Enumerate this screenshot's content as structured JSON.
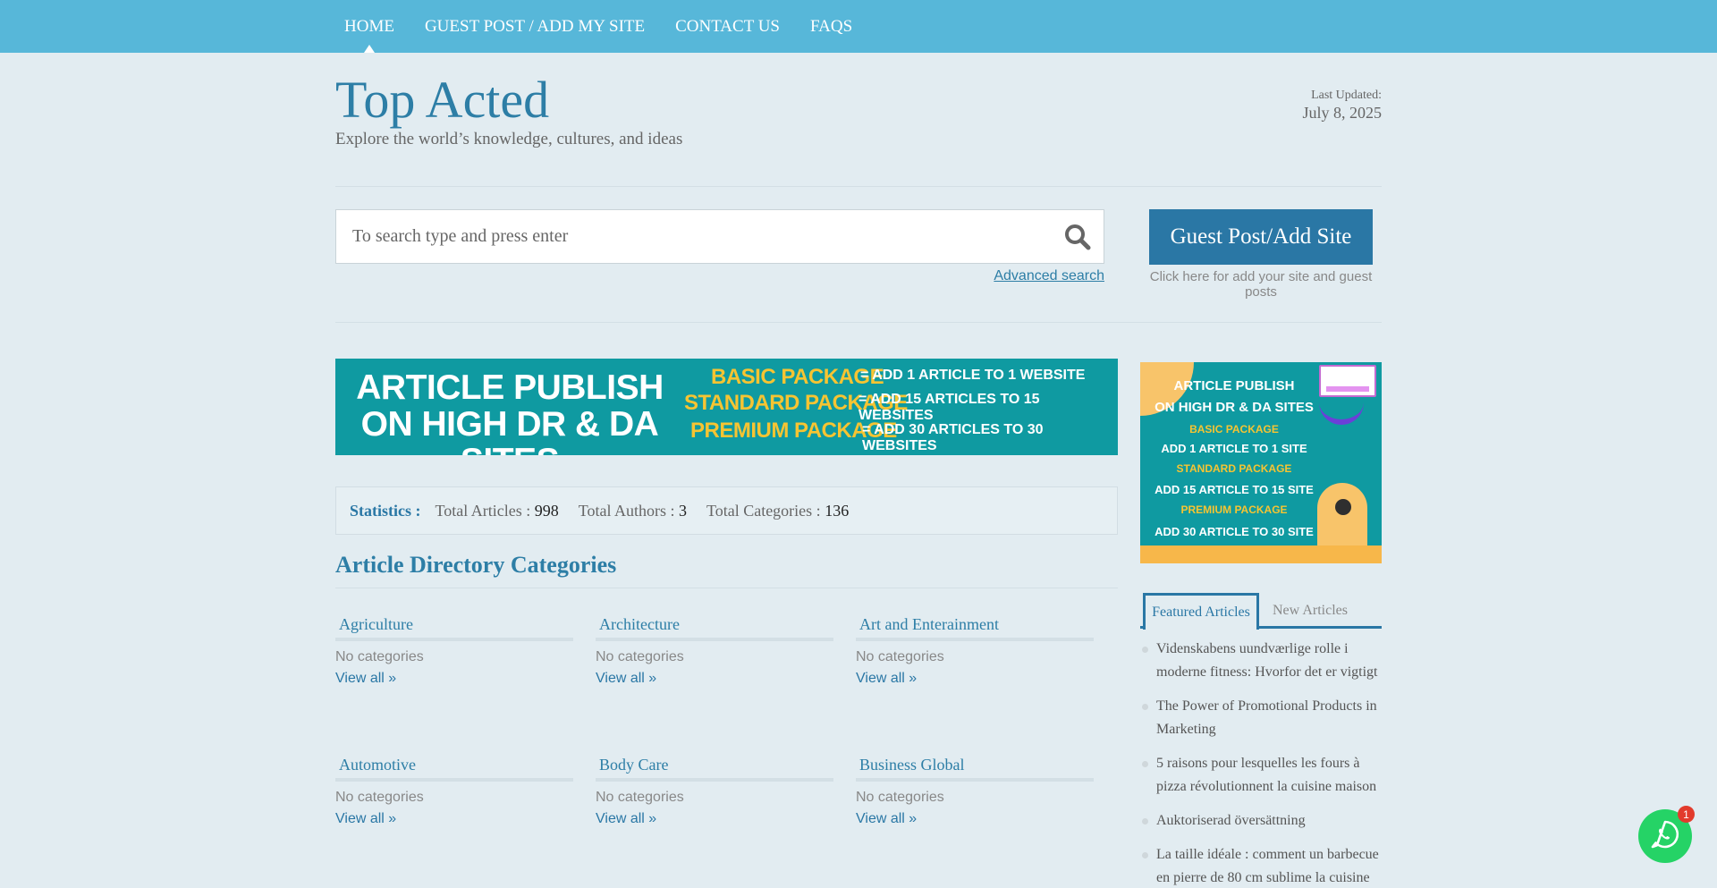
{
  "nav": {
    "items": [
      {
        "label": "HOME"
      },
      {
        "label": "GUEST POST / ADD MY SITE"
      },
      {
        "label": "CONTACT US"
      },
      {
        "label": "FAQS"
      }
    ]
  },
  "header": {
    "title": "Top Acted",
    "description": "Explore the world’s knowledge, cultures, and ideas",
    "updated_label": "Last Updated:",
    "updated_date": "July 8, 2025"
  },
  "search": {
    "placeholder": "To search type and press enter",
    "advanced_label": "Advanced search"
  },
  "guest_post": {
    "button_label": "Guest Post/Add Site",
    "caption": "Click here for add your site and guest posts"
  },
  "banner": {
    "title_line1": "ARTICLE PUBLISH",
    "title_line2": "ON HIGH DR & DA SITES",
    "packages": [
      {
        "name": "BASIC PACKAGE",
        "desc": "= ADD 1 ARTICLE TO 1 WEBSITE"
      },
      {
        "name": "STANDARD PACKAGE",
        "desc": "= ADD 15 ARTICLES TO 15 WEBSITES"
      },
      {
        "name": "PREMIUM PACKAGE",
        "desc": "= ADD 30 ARTICLES TO 30 WEBSITES"
      }
    ]
  },
  "side_ad": {
    "line1": "ARTICLE PUBLISH",
    "line2": "ON HIGH DR & DA SITES",
    "basic": "BASIC PACKAGE",
    "basic_desc": "ADD 1 ARTICLE TO 1 SITE",
    "standard": "STANDARD PACKAGE",
    "standard_desc": "ADD 15 ARTICLE TO 15 SITE",
    "premium": "PREMIUM PACKAGE",
    "premium_desc": "ADD 30 ARTICLE TO 30 SITE"
  },
  "stats": {
    "label": "Statistics :",
    "articles_label": "Total Articles :",
    "articles_value": "998",
    "authors_label": "Total Authors :",
    "authors_value": "3",
    "categories_label": "Total Categories :",
    "categories_value": "136"
  },
  "section_title": "Article Directory Categories",
  "categories": [
    {
      "name": "Agriculture",
      "none": "No categories",
      "view": "View all »"
    },
    {
      "name": "Architecture",
      "none": "No categories",
      "view": "View all »"
    },
    {
      "name": "Art and Enterainment",
      "none": "No categories",
      "view": "View all »"
    },
    {
      "name": "Automotive",
      "none": "No categories",
      "view": "View all »"
    },
    {
      "name": "Body Care",
      "none": "No categories",
      "view": "View all »"
    },
    {
      "name": "Business Global",
      "none": "No categories",
      "view": "View all »"
    }
  ],
  "tabs": {
    "featured": "Featured Articles",
    "new": "New Articles"
  },
  "articles": [
    "Videnskabens uundværlige rolle i moderne fitness: Hvorfor det er vigtigt",
    "The Power of Promotional Products in Marketing",
    "5 raisons pour lesquelles les fours à pizza révolutionnent la cuisine maison",
    "Auktoriserad översättning",
    "La taille idéale : comment un barbecue en pierre de 80 cm sublime la cuisine"
  ],
  "whatsapp": {
    "badge": "1",
    "icon": "whatsapp-icon",
    "color": "#25d366"
  },
  "colors": {
    "nav_bg": "#57b7d9",
    "accent": "#2a77a5",
    "page_bg": "#e2ecf1"
  }
}
